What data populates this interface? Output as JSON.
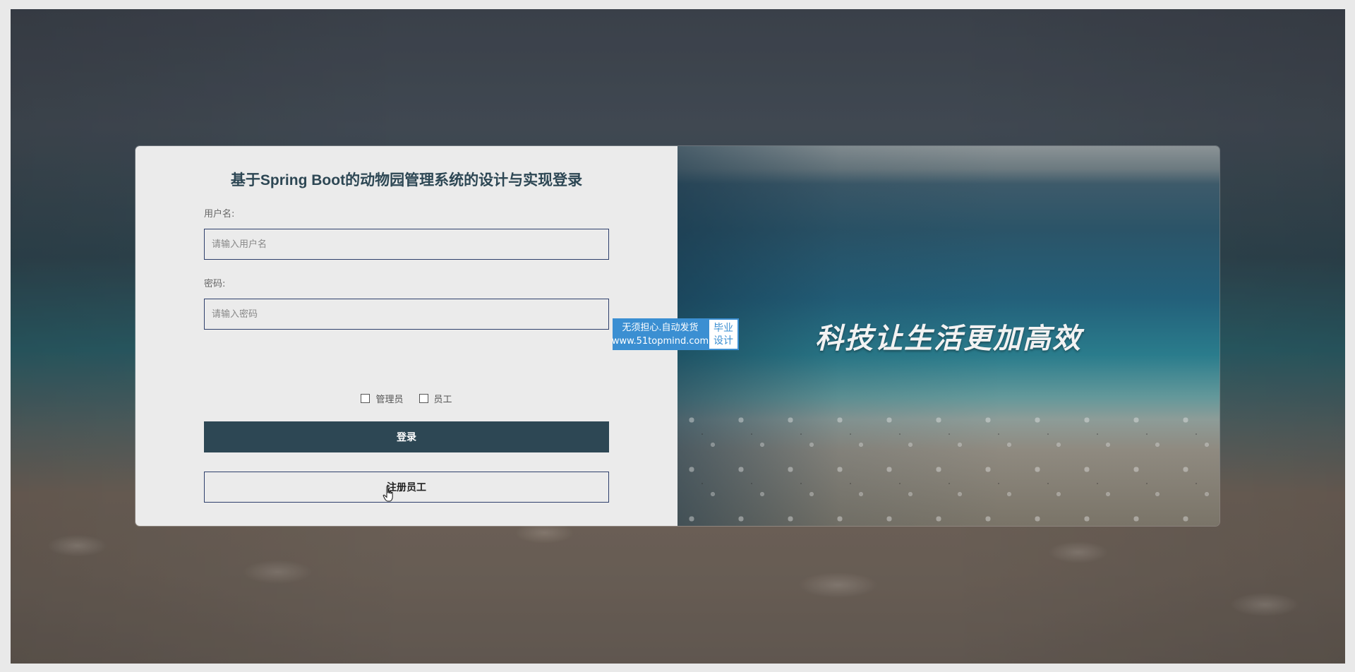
{
  "login": {
    "title": "基于Spring Boot的动物园管理系统的设计与实现登录",
    "username_label": "用户名:",
    "username_placeholder": "请输入用户名",
    "password_label": "密码:",
    "password_placeholder": "请输入密码",
    "roles": [
      "管理员",
      "员工"
    ],
    "login_button": "登录",
    "register_button": "注册员工"
  },
  "banner": {
    "slogan": "科技让生活更加高效"
  },
  "watermark": {
    "line1": "无须担心.自动发货",
    "line2": "www.51topmind.com",
    "side1": "毕业",
    "side2": "设计"
  },
  "colors": {
    "primary": "#2d4754",
    "input_border": "#2e3f6b",
    "panel_bg": "#ebebeb",
    "watermark_blue": "#3b8fd2"
  }
}
